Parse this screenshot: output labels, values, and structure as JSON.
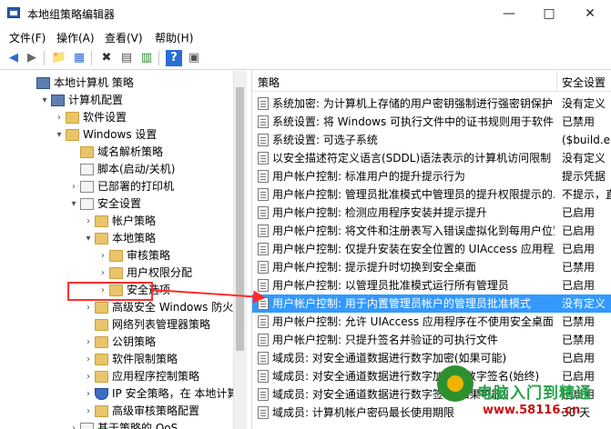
{
  "window": {
    "title": "本地组策略编辑器"
  },
  "menu": [
    "文件(F)",
    "操作(A)",
    "查看(V)",
    "帮助(H)"
  ],
  "tree": [
    {
      "label": "本地计算机 策略",
      "level": 0,
      "expander": "",
      "icon": "computer"
    },
    {
      "label": "计算机配置",
      "level": 1,
      "expander": "▾",
      "icon": "computer"
    },
    {
      "label": "软件设置",
      "level": 2,
      "expander": "›",
      "icon": "folder"
    },
    {
      "label": "Windows 设置",
      "level": 2,
      "expander": "▾",
      "icon": "folder"
    },
    {
      "label": "域名解析策略",
      "level": 3,
      "expander": "",
      "icon": "folder"
    },
    {
      "label": "脚本(启动/关机)",
      "level": 3,
      "expander": "",
      "icon": "doc"
    },
    {
      "label": "已部署的打印机",
      "level": 3,
      "expander": "›",
      "icon": "doc"
    },
    {
      "label": "安全设置",
      "level": 3,
      "expander": "▾",
      "icon": "doc"
    },
    {
      "label": "帐户策略",
      "level": 4,
      "expander": "›",
      "icon": "folder"
    },
    {
      "label": "本地策略",
      "level": 4,
      "expander": "▾",
      "icon": "folder"
    },
    {
      "label": "审核策略",
      "level": 5,
      "expander": "›",
      "icon": "folder"
    },
    {
      "label": "用户权限分配",
      "level": 5,
      "expander": "›",
      "icon": "folder"
    },
    {
      "label": "安全选项",
      "level": 5,
      "expander": "›",
      "icon": "folder"
    },
    {
      "label": "高级安全 Windows 防火墙",
      "level": 4,
      "expander": "›",
      "icon": "folder"
    },
    {
      "label": "网络列表管理器策略",
      "level": 4,
      "expander": "",
      "icon": "folder"
    },
    {
      "label": "公钥策略",
      "level": 4,
      "expander": "›",
      "icon": "folder"
    },
    {
      "label": "软件限制策略",
      "level": 4,
      "expander": "›",
      "icon": "folder"
    },
    {
      "label": "应用程序控制策略",
      "level": 4,
      "expander": "›",
      "icon": "folder"
    },
    {
      "label": "IP 安全策略，在 本地计算机",
      "level": 4,
      "expander": "›",
      "icon": "shield"
    },
    {
      "label": "高级审核策略配置",
      "level": 4,
      "expander": "›",
      "icon": "folder"
    },
    {
      "label": "基于策略的 QoS",
      "level": 3,
      "expander": "›",
      "icon": "doc"
    }
  ],
  "columns": {
    "policy": "策略",
    "setting": "安全设置"
  },
  "policies": [
    {
      "name": "系统加密: 为计算机上存储的用户密钥强制进行强密钥保护",
      "value": "没有定义"
    },
    {
      "name": "系统设置: 将 Windows 可执行文件中的证书规则用于软件...",
      "value": "已禁用"
    },
    {
      "name": "系统设置: 可选子系统",
      "value": "($build.en"
    },
    {
      "name": "以安全描述符定义语言(SDDL)语法表示的计算机访问限制",
      "value": "没有定义"
    },
    {
      "name": "用户帐户控制: 标准用户的提升提示行为",
      "value": "提示凭据"
    },
    {
      "name": "用户帐户控制: 管理员批准模式中管理员的提升权限提示的...",
      "value": "不提示，直"
    },
    {
      "name": "用户帐户控制: 检测应用程序安装并提示提升",
      "value": "已启用"
    },
    {
      "name": "用户帐户控制: 将文件和注册表写入错误虚拟化到每用户位置",
      "value": "已启用"
    },
    {
      "name": "用户帐户控制: 仅提升安装在安全位置的 UIAccess 应用程序",
      "value": "已启用"
    },
    {
      "name": "用户帐户控制: 提示提升时切换到安全桌面",
      "value": "已禁用"
    },
    {
      "name": "用户帐户控制: 以管理员批准模式运行所有管理员",
      "value": "已启用"
    },
    {
      "name": "用户帐户控制: 用于内置管理员帐户的管理员批准模式",
      "value": "没有定义"
    },
    {
      "name": "用户帐户控制: 允许 UIAccess 应用程序在不使用安全桌面...",
      "value": "已禁用"
    },
    {
      "name": "用户帐户控制: 只提升签名并验证的可执行文件",
      "value": "已禁用"
    },
    {
      "name": "域成员: 对安全通道数据进行数字加密(如果可能)",
      "value": "已启用"
    },
    {
      "name": "域成员: 对安全通道数据进行数字加密或数字签名(始终)",
      "value": "已启用"
    },
    {
      "name": "域成员: 对安全通道数据进行数字签名(如果可能)",
      "value": "已启用"
    },
    {
      "name": "域成员: 计算机帐户密码最长使用期限",
      "value": "30 天"
    }
  ],
  "selected_index": 11,
  "watermark": {
    "line1": "电脑入门到精通",
    "line2": "www.58116.cn"
  }
}
